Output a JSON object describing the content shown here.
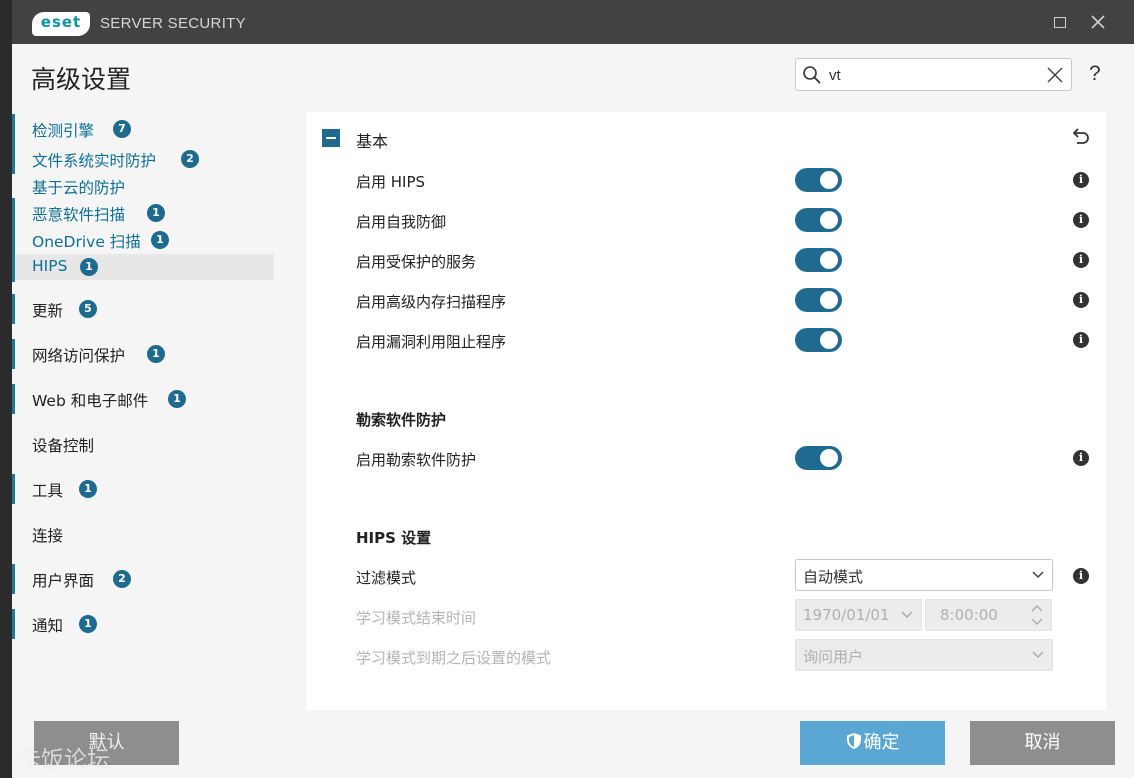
{
  "titlebar": {
    "logo_text": "eset",
    "app_title": "SERVER SECURITY"
  },
  "header": {
    "title": "高级设置",
    "search": {
      "value": "vt",
      "placeholder": ""
    },
    "help": "?"
  },
  "sidebar": {
    "items": [
      {
        "label": "检测引擎",
        "badge": "7"
      },
      {
        "label": "文件系统实时防护",
        "badge": "2"
      },
      {
        "label": "基于云的防护",
        "badge": ""
      },
      {
        "label": "恶意软件扫描",
        "badge": "1"
      },
      {
        "label": "OneDrive 扫描",
        "badge": "1"
      },
      {
        "label": "HIPS",
        "badge": "1"
      },
      {
        "label": "更新",
        "badge": "5"
      },
      {
        "label": "网络访问保护",
        "badge": "1"
      },
      {
        "label": "Web 和电子邮件",
        "badge": "1"
      },
      {
        "label": "设备控制",
        "badge": ""
      },
      {
        "label": "工具",
        "badge": "1"
      },
      {
        "label": "连接",
        "badge": ""
      },
      {
        "label": "用户界面",
        "badge": "2"
      },
      {
        "label": "通知",
        "badge": "1"
      }
    ],
    "selected": "HIPS"
  },
  "main": {
    "section_title": "基本",
    "toggles": [
      {
        "label": "启用 HIPS",
        "on": true
      },
      {
        "label": "启用自我防御",
        "on": true
      },
      {
        "label": "启用受保护的服务",
        "on": true
      },
      {
        "label": "启用高级内存扫描程序",
        "on": true
      },
      {
        "label": "启用漏洞利用阻止程序",
        "on": true
      }
    ],
    "ransomware": {
      "heading": "勒索软件防护",
      "toggle_label": "启用勒索软件防护",
      "on": true
    },
    "hips_settings": {
      "heading": "HIPS 设置",
      "filter_mode_label": "过滤模式",
      "filter_mode_value": "自动模式",
      "learning_end_label": "学习模式结束时间",
      "learning_end_date": "1970/01/01",
      "learning_end_time": "8:00:00",
      "after_expiry_label": "学习模式到期之后设置的模式",
      "after_expiry_value": "询问用户"
    }
  },
  "footer": {
    "default_label": "默认",
    "ok_label": "确定",
    "cancel_label": "取消"
  },
  "watermark": "卡饭论坛",
  "colors": {
    "accent": "#1e6b8f",
    "ok_button": "#5aa7d3",
    "gray_button": "#8e8e8e",
    "titlebar": "#424242"
  }
}
